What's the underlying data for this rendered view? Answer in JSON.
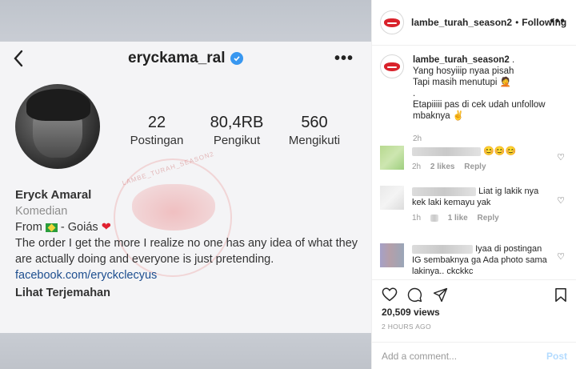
{
  "profile_shot": {
    "username": "eryckama_ral",
    "stats": [
      {
        "num": "22",
        "label": "Postingan"
      },
      {
        "num": "80,4RB",
        "label": "Pengikut"
      },
      {
        "num": "560",
        "label": "Mengikuti"
      }
    ],
    "name": "Eryck Amaral",
    "category": "Komedian",
    "from_prefix": "From",
    "from_suffix": "- Goiás",
    "bio": "The order I get the more I realize no one has any idea of what they are actually doing and everyone is just pretending.",
    "link": "facebook.com/eryckclecyus",
    "translate": "Lihat Terjemahan",
    "watermark": "LAMBE_TURAH_SEASON2"
  },
  "post": {
    "author": "lambe_turah_season2",
    "dot": "•",
    "follow_state": "Following",
    "more": "•••",
    "caption_user": "lambe_turah_season2",
    "caption_after_user": ".",
    "caption_lines": [
      "Yang hosyiiip nyaa pisah",
      "Tapi masih menutupi 🤦",
      ".",
      "Etapiiiii pas di cek udah unfollow mbaknya ✌"
    ],
    "caption_time": "2h",
    "comments": [
      {
        "text": "😊😊😊",
        "time": "2h",
        "likes": "2 likes",
        "reply": "Reply"
      },
      {
        "text": "Liat ig lakik nya kek laki kemayu yak",
        "time": "1h",
        "likes": "1 like",
        "reply": "Reply"
      },
      {
        "text": "Iyaa di postingan IG sembaknya ga Ada photo sama lakinya.. ckckkc",
        "time": "",
        "likes": "",
        "reply": ""
      }
    ],
    "views": "20,509 views",
    "ago": "2 HOURS AGO",
    "add_comment_placeholder": "Add a comment...",
    "post_label": "Post"
  },
  "colors": {
    "accent": "#3897f0",
    "brand_lips": "#d9222b",
    "link": "#1d4e8f"
  }
}
